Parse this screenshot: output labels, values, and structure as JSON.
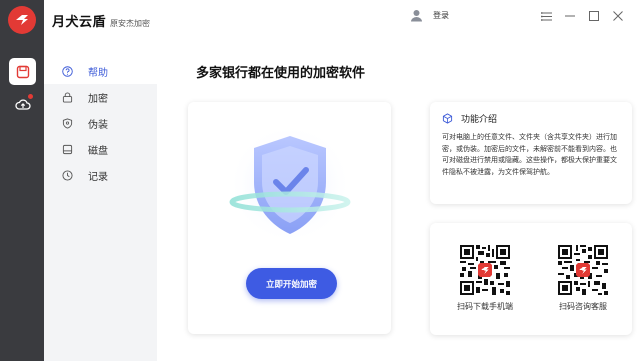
{
  "app": {
    "name": "月犬云盾",
    "subtitle": "原安杰加密",
    "brand_color": "#e23a35",
    "accent": "#3e5be3"
  },
  "titlebar": {
    "login_label": "登录"
  },
  "nav": {
    "items": [
      {
        "label": "帮助",
        "icon": "help-icon",
        "active": true
      },
      {
        "label": "加密",
        "icon": "lock-icon",
        "active": false
      },
      {
        "label": "伪装",
        "icon": "mask-icon",
        "active": false
      },
      {
        "label": "磁盘",
        "icon": "disk-icon",
        "active": false
      },
      {
        "label": "记录",
        "icon": "clock-icon",
        "active": false
      }
    ]
  },
  "main": {
    "headline": "多家银行都在使用的加密软件",
    "start_button": "立即开始加密"
  },
  "info": {
    "title": "功能介绍",
    "body": "可对电脑上的任意文件、文件夹（含共享文件夹）进行加密，或伪装。加密后的文件，未解密前不能看到内容。也可对磁盘进行禁用或隐藏。这些操作，都极大保护重要文件隐私不被泄露，为文件保驾护航。"
  },
  "qr": {
    "download_label": "扫码下载手机端",
    "support_label": "扫码咨询客服"
  }
}
